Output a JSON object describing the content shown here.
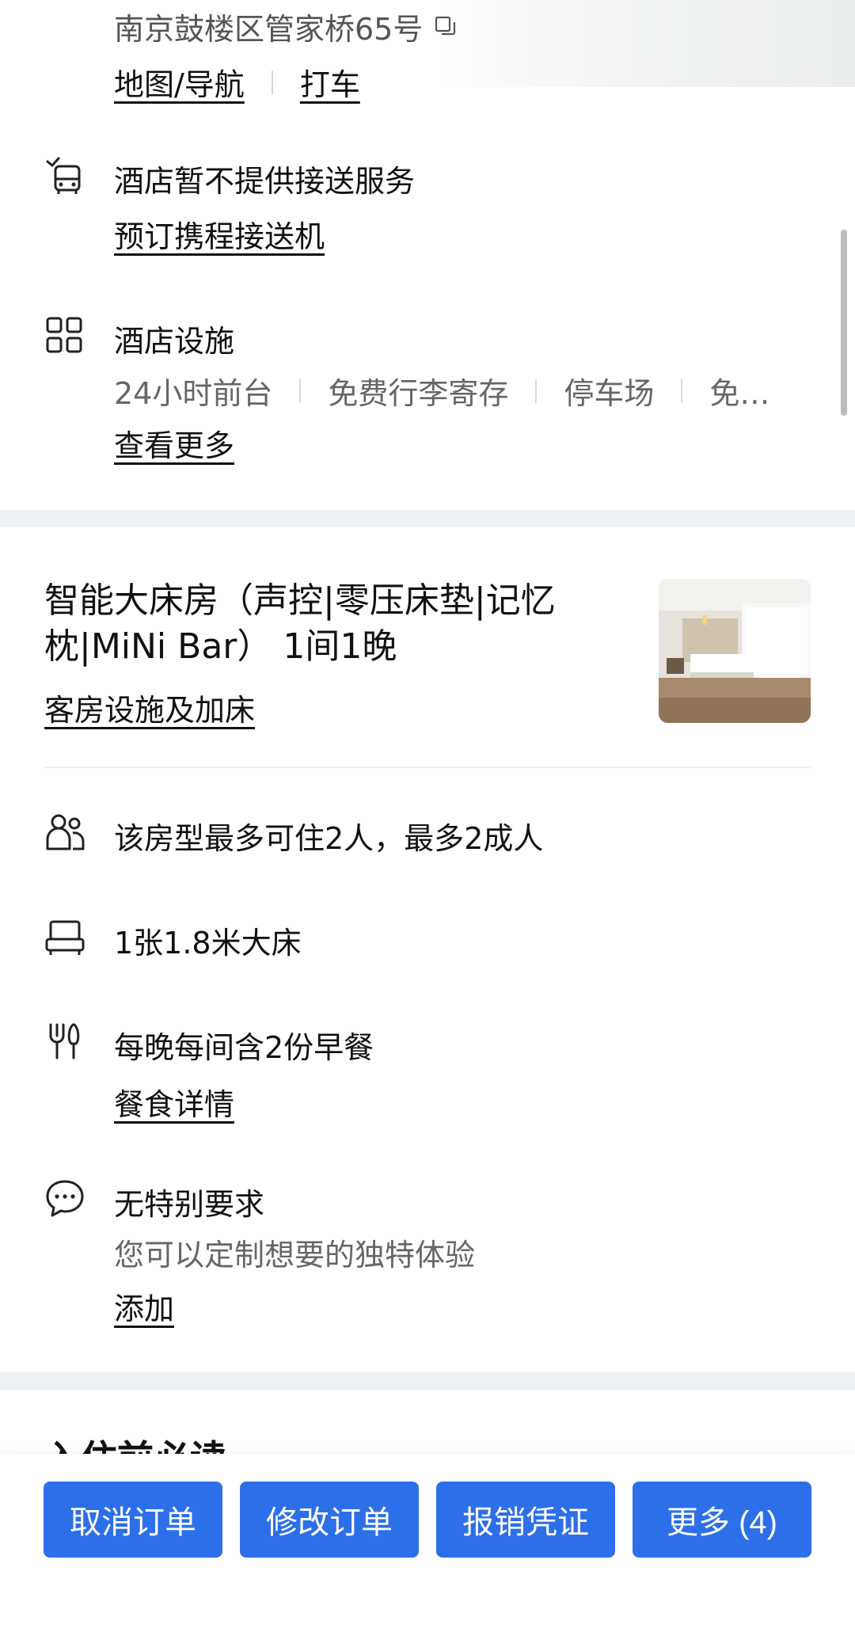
{
  "hotel": {
    "address": "南京鼓楼区管家桥65号",
    "map_link": "地图/导航",
    "taxi_link": "打车"
  },
  "shuttle": {
    "title": "酒店暂不提供接送服务",
    "link": "预订携程接送机"
  },
  "facilities": {
    "title": "酒店设施",
    "items": [
      "24小时前台",
      "免费行李寄存",
      "停车场",
      "免…"
    ],
    "more_link": "查看更多"
  },
  "room": {
    "title": "智能大床房（声控|零压床垫|记忆枕|MiNi Bar） 1间1晚",
    "facilities_link": "客房设施及加床"
  },
  "details": {
    "occupancy": "该房型最多可住2人，最多2成人",
    "bed": "1张1.8米大床",
    "meal": "每晚每间含2份早餐",
    "meal_link": "餐食详情",
    "request_title": "无特别要求",
    "request_sub": "您可以定制想要的独特体验",
    "request_link": "添加"
  },
  "next_section_title": "入住前必读",
  "actions": {
    "cancel": "取消订单",
    "modify": "修改订单",
    "invoice": "报销凭证",
    "more": "更多 (4)"
  },
  "colors": {
    "primary": "#2d6fe8",
    "divider_band": "#edf0f5"
  },
  "icons": [
    "copy-icon",
    "shuttle-bus-icon",
    "facilities-grid-icon",
    "guests-icon",
    "bed-icon",
    "cutlery-icon",
    "chat-bubble-icon"
  ]
}
